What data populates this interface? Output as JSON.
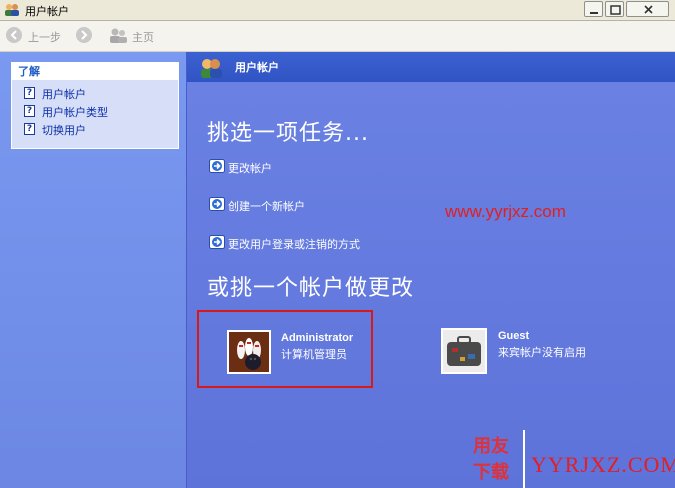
{
  "window": {
    "title": "用户帐户",
    "icon": "user-accounts-icon"
  },
  "toolbar": {
    "back_label": "上一步",
    "home_label": "主页"
  },
  "sidebar": {
    "heading": "了解",
    "items": [
      {
        "label": "用户帐户",
        "icon": "help-icon"
      },
      {
        "label": "用户帐户类型",
        "icon": "help-icon"
      },
      {
        "label": "切换用户",
        "icon": "help-icon"
      }
    ]
  },
  "main": {
    "header_title": "用户帐户",
    "pick_task_heading": "挑选一项任务...",
    "tasks": [
      {
        "label": "更改帐户",
        "icon": "arrow-right-icon"
      },
      {
        "label": "创建一个新帐户",
        "icon": "arrow-right-icon"
      },
      {
        "label": "更改用户登录或注销的方式",
        "icon": "arrow-right-icon"
      }
    ],
    "watermark": "www.yyrjxz.com",
    "pick_account_heading": "或挑一个帐户做更改",
    "accounts": [
      {
        "name": "Administrator",
        "description": "计算机管理员",
        "picture": "bowling-icon",
        "highlighted": true
      },
      {
        "name": "Guest",
        "description": "来宾帐户没有启用",
        "picture": "suitcase-icon"
      }
    ]
  },
  "logo": {
    "badge_top": "用友",
    "badge_bottom": "下载",
    "brand": "YYRJXZ.COM"
  },
  "colors": {
    "main_bg": "#6f82e2",
    "header_bar": "#3458c8",
    "highlight_border": "#d8191a",
    "watermark": "#e11f1f"
  }
}
